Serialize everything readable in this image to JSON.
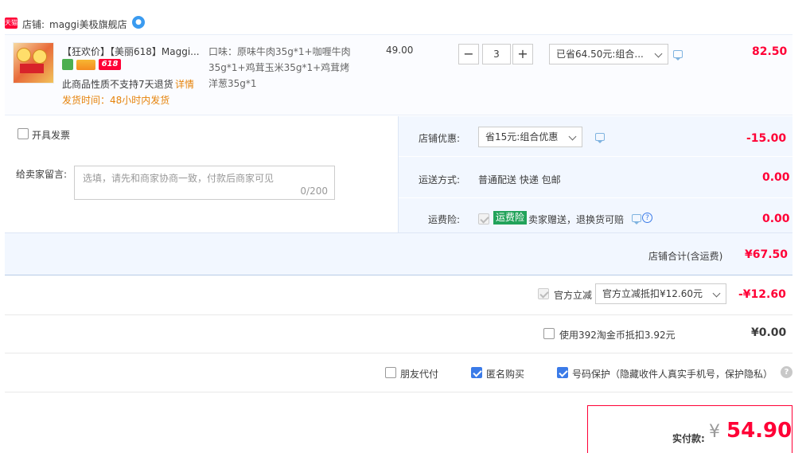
{
  "shop": {
    "tmall_badge": "天猫",
    "prefix": "店铺:",
    "name": "maggi美极旗舰店"
  },
  "item": {
    "title": "【狂欢价】【美丽618】Maggi...",
    "badge_618": "618",
    "return_note": "此商品性质不支持7天退货",
    "return_link": "详情",
    "ship_time": "发货时间：48小时内发货",
    "spec_line1": "口味：原味牛肉35g*1+咖喱牛肉",
    "spec_line2": "35g*1+鸡茸玉米35g*1+鸡茸烤",
    "spec_line3": "洋葱35g*1",
    "price": "49.00",
    "qty": "3",
    "minus": "−",
    "plus": "+",
    "discount_select": "已省64.50元:组合...",
    "subtotal": "82.50"
  },
  "invoice": {
    "label": "开具发票"
  },
  "message": {
    "label": "给卖家留言:",
    "placeholder": "选填，请先和商家协商一致，付款后商家可见",
    "counter": "0/200"
  },
  "shop_discount": {
    "label": "店铺优惠:",
    "select": "省15元:组合优惠",
    "value": "-15.00"
  },
  "delivery": {
    "label": "运送方式:",
    "method": "普通配送 快递 包邮",
    "value": "0.00"
  },
  "insurance": {
    "label": "运费险:",
    "tag": "运费险",
    "text": "卖家赠送，退换货可赔",
    "value": "0.00"
  },
  "shop_total": {
    "label": "店铺合计(含运费)",
    "value": "¥67.50"
  },
  "official": {
    "label": "官方立减",
    "select": "官方立减抵扣¥12.60元",
    "value": "-¥12.60"
  },
  "coins": {
    "label": "使用392淘金币抵扣3.92元",
    "value": "¥0.00"
  },
  "options": {
    "friend_pay": "朋友代付",
    "anonymous": "匿名购买",
    "phone_protect": "号码保护（隐藏收件人真实手机号，保护隐私）",
    "help": "?"
  },
  "pay": {
    "label": "实付款:",
    "currency": "¥",
    "amount": "54.90"
  }
}
